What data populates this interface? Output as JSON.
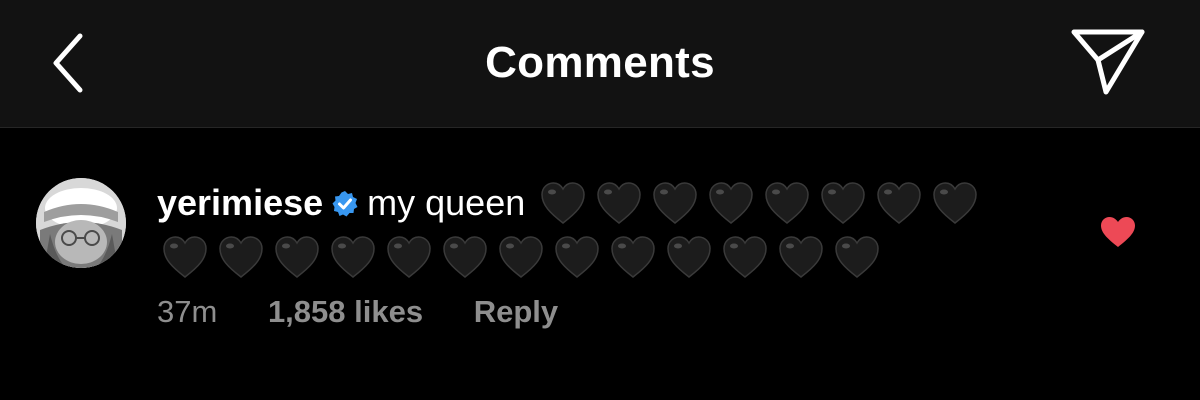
{
  "header": {
    "title": "Comments",
    "back_icon": "chevron-left-icon",
    "share_icon": "paper-plane-icon"
  },
  "comment": {
    "username": "yerimiese",
    "verified": true,
    "text": "my queen",
    "hearts_count": 21,
    "heart_emoji": "black-heart-emoji",
    "time": "37m",
    "likes": "1,858 likes",
    "reply_label": "Reply",
    "liked": true
  },
  "colors": {
    "background": "#000000",
    "header_background": "#121212",
    "text_primary": "#ffffff",
    "text_secondary": "#8e8e8e",
    "verified_badge": "#3897f0",
    "like_heart": "#ed4956"
  }
}
